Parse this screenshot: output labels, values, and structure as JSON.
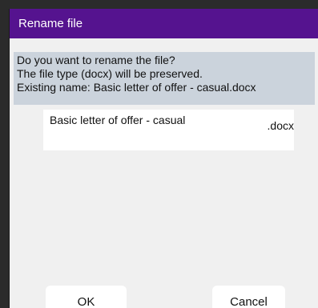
{
  "dialog": {
    "title": "Rename file",
    "message_lines": [
      "Do you want to rename the file?",
      "The file type (docx) will be preserved.",
      "Existing name: Basic letter of offer - casual.docx"
    ],
    "filename_value": "Basic letter of offer - casual",
    "extension": ".docx",
    "ok_label": "OK",
    "cancel_label": "Cancel"
  },
  "colors": {
    "titlebar": "#55138f",
    "message_background": "#cbd3dc",
    "dialog_background": "#f0f0f0"
  }
}
